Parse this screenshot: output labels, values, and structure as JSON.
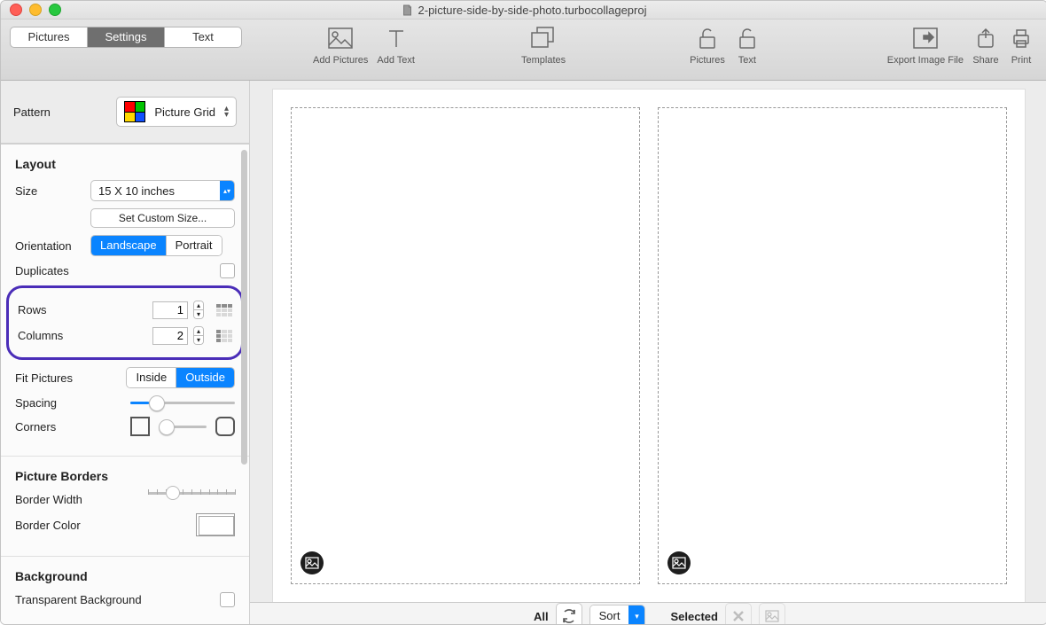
{
  "title": "2-picture-side-by-side-photo.turbocollageproj",
  "tabs": {
    "pictures": "Pictures",
    "settings": "Settings",
    "text": "Text"
  },
  "toolbar": {
    "add_pictures": "Add Pictures",
    "add_text": "Add Text",
    "templates": "Templates",
    "lock_pictures": "Pictures",
    "lock_text": "Text",
    "export": "Export Image File",
    "share": "Share",
    "print": "Print"
  },
  "pattern": {
    "label": "Pattern",
    "name": "Picture Grid"
  },
  "layout": {
    "heading": "Layout",
    "size_label": "Size",
    "size_value": "15 X 10 inches",
    "custom_size": "Set Custom Size...",
    "orientation_label": "Orientation",
    "landscape": "Landscape",
    "portrait": "Portrait",
    "duplicates_label": "Duplicates",
    "rows_label": "Rows",
    "rows_value": "1",
    "cols_label": "Columns",
    "cols_value": "2",
    "fit_label": "Fit Pictures",
    "fit_inside": "Inside",
    "fit_outside": "Outside",
    "spacing_label": "Spacing",
    "corners_label": "Corners"
  },
  "borders": {
    "heading": "Picture Borders",
    "width_label": "Border Width",
    "color_label": "Border Color"
  },
  "background": {
    "heading": "Background",
    "transparent_label": "Transparent Background"
  },
  "bottom": {
    "all": "All",
    "sort": "Sort",
    "selected": "Selected"
  }
}
